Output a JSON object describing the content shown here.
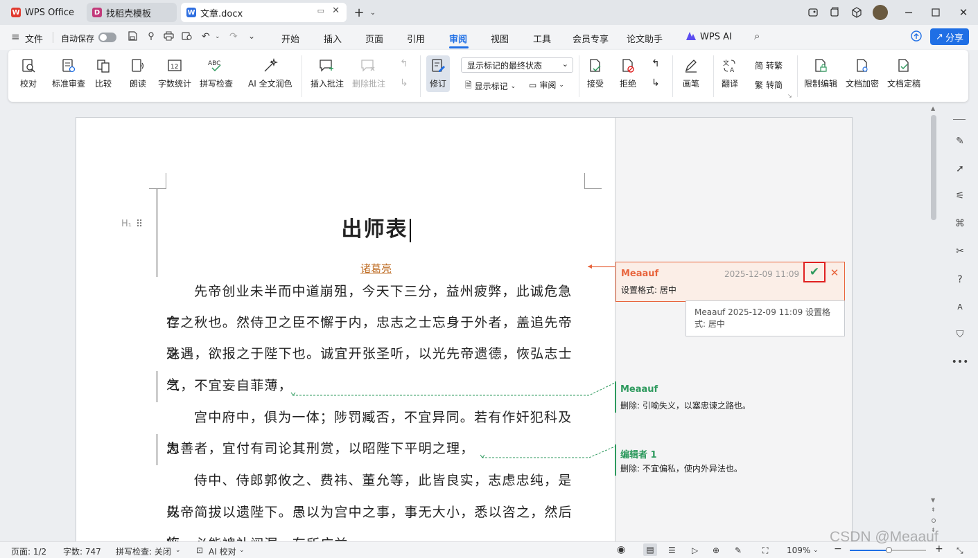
{
  "tabs": [
    {
      "label": "WPS Office"
    },
    {
      "label": "找稻壳模板"
    },
    {
      "label": "文章.docx"
    }
  ],
  "menu": {
    "file": "文件",
    "autosave": "自动保存",
    "items": [
      "开始",
      "插入",
      "页面",
      "引用",
      "审阅",
      "视图",
      "工具",
      "会员专享",
      "论文助手"
    ],
    "ai": "WPS AI",
    "share": "分享"
  },
  "ribbon": {
    "proofread": "校对",
    "standard_review": "标准审查",
    "compare": "比较",
    "read_aloud": "朗读",
    "word_count": "字数统计",
    "spell_check": "拼写检查",
    "ai_polish": "AI 全文润色",
    "insert_comment": "插入批注",
    "delete_comment": "删除批注",
    "track": "修订",
    "display_mode": "显示标记的最终状态",
    "show_markup": "显示标记",
    "review_pane": "审阅",
    "accept": "接受",
    "reject": "拒绝",
    "ink": "画笔",
    "translate": "翻译",
    "to_traditional": "转繁",
    "to_simplified": "转简",
    "restrict_edit": "限制编辑",
    "encrypt": "文档加密",
    "finalize": "文档定稿"
  },
  "doc": {
    "heading_marker": "H₁",
    "title": "出师表",
    "author": "诸葛亮",
    "lines": [
      "先帝创业未半而中道崩殂，今天下三分，益州疲弊，此诚危急存",
      "亡之秋也。然侍卫之臣不懈于内，忠志之士忘身于外者，盖追先帝之",
      "殊遇，欲报之于陛下也。诚宜开张圣听，以光先帝遗德，恢弘志士之",
      "气，不宜妄自菲薄，",
      "宫中府中，俱为一体；陟罚臧否，不宜异同。若有作奸犯科及为",
      "忠善者，宜付有司论其刑赏，以昭陛下平明之理，",
      "侍中、侍郎郭攸之、费祎、董允等，此皆良实，志虑忠纯，是以",
      "先帝简拔以遗陛下。愚以为宫中之事，事无大小，悉以咨之，然后施",
      "行，必能裨补阙漏，有所广益。"
    ]
  },
  "comments": [
    {
      "author": "Meaauf",
      "time": "2025-12-09 11:09",
      "text": "设置格式: 居中",
      "tooltip": "Meaauf 2025-12-09 11:09 设置格式: 居中"
    },
    {
      "author": "Meaauf",
      "text": "删除: 引喻失义，以塞忠谏之路也。"
    },
    {
      "author": "编辑者 1",
      "text": "删除: 不宜偏私，使内外异法也。"
    }
  ],
  "status": {
    "page": "页面: 1/2",
    "words": "字数: 747",
    "spell": "拼写检查: 关闭",
    "ai_check": "AI 校对",
    "zoom": "109%",
    "watermark": "CSDN @Meaauf"
  },
  "colors": {
    "accent": "#1f6fe5",
    "comment_orange": "#e8643c",
    "comment_green": "#2e9a5e",
    "highlight_red": "#e02020"
  }
}
